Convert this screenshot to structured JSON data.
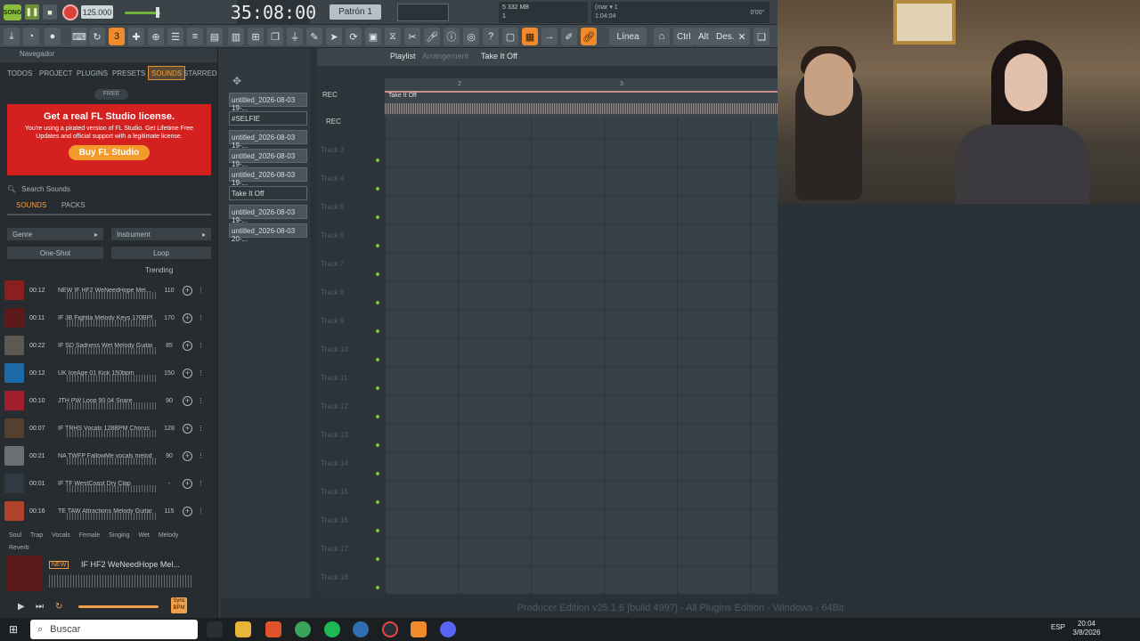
{
  "app": {
    "logo_text": "SONG",
    "tempo": "125.000",
    "time": "35:08:00",
    "pattern": "Patrón 1",
    "cpu_line1": "5      332 MB",
    "cpu_line2": "1",
    "hint_line1": "(mar  ▾   1",
    "hint_line2": "1:04:04",
    "hint_right": "0'00\"",
    "snap": "Línea",
    "toolbar_labels": [
      "Ctrl",
      "Alt",
      "Des."
    ]
  },
  "browser": {
    "nav_label": "Navegador",
    "tabs": [
      "TODOS",
      "PROJECT",
      "PLUGINS",
      "PRESETS",
      "SOUNDS",
      "STARRED"
    ],
    "free_badge": "FREE",
    "ad": {
      "title": "Get a real FL Studio license.",
      "text": "You're using a pirated version of FL Studio. Get Lifetime Free Updates and official support with a legitimate license.",
      "button": "Buy FL Studio"
    },
    "search_placeholder": "Search Sounds",
    "subtabs": [
      "SOUNDS",
      "PACKS"
    ],
    "filter_genre": "Genre",
    "filter_instrument": "Instrument",
    "oneshot": "One-Shot",
    "loop": "Loop",
    "trending": "Trending",
    "sounds": [
      {
        "dur": "00:12",
        "name": "NEW  IF HF2 WeNeedHope Mel...",
        "bpm": "110",
        "color": "#8b1e1e"
      },
      {
        "dur": "00:11",
        "name": "IF JB Fightla Melody Keys 170BPM...",
        "bpm": "170",
        "color": "#5e1a1a"
      },
      {
        "dur": "00:22",
        "name": "IF SD Sadness Wet Melody Guitar...",
        "bpm": "85",
        "color": "#5c5a52"
      },
      {
        "dur": "00:12",
        "name": "UK IceAge 01 Kick 150bpm",
        "bpm": "150",
        "color": "#1e6aa6"
      },
      {
        "dur": "00:10",
        "name": "JTH PW Loop 90 04 Snare",
        "bpm": "90",
        "color": "#a01e2e"
      },
      {
        "dur": "00:07",
        "name": "IF TRHS Vocals 128BPM Chorus",
        "bpm": "128",
        "color": "#54402f"
      },
      {
        "dur": "00:21",
        "name": "NA TWFP FallowMe vocals melody...",
        "bpm": "90",
        "color": "#6b7075"
      },
      {
        "dur": "00:01",
        "name": "IF TF WestCoast Dry Clap",
        "bpm": "-",
        "color": "#2f3a44"
      },
      {
        "dur": "00:16",
        "name": "TE TAW Attractions Melody Guitar...",
        "bpm": "115",
        "color": "#b0432b"
      }
    ],
    "tags": [
      "Soul",
      "Trap",
      "Vocals",
      "Female",
      "Singing",
      "Wet",
      "Melody",
      "Reverb"
    ],
    "player": {
      "name": "IF HF2 WeNeedHope Mel...",
      "new": "NEW",
      "sync": "Sync BPM"
    }
  },
  "patterns": [
    "untitled_2026-08-03 19-...",
    "#SELFIE",
    "untitled_2026-08-03 19-...",
    "untitled_2026-08-03 19-...",
    "untitled_2026-08-03 19-...",
    "Take It Off",
    "untitled_2026-08-03 19-...",
    "untitled_2026-08-03 20-..."
  ],
  "playlist": {
    "title": "Playlist",
    "subtitle": "Arrangement",
    "arrangement": "Take It Off",
    "clip_name": "Take It Off",
    "rec": "REC",
    "ruler": [
      "2",
      "3"
    ],
    "tracks": [
      "Track 3",
      "Track 4",
      "Track 5",
      "Track 6",
      "Track 7",
      "Track 8",
      "Track 9",
      "Track 10",
      "Track 11",
      "Track 12",
      "Track 13",
      "Track 14",
      "Track 15",
      "Track 16",
      "Track 17",
      "Track 18"
    ]
  },
  "status": "Producer Edition v25.1.6 [build 4997] - All Plugins Edition - Windows - 64Bit",
  "taskbar": {
    "search": "Buscar",
    "lang": "ESP",
    "time": "20:04",
    "date": "3/8/2026"
  }
}
